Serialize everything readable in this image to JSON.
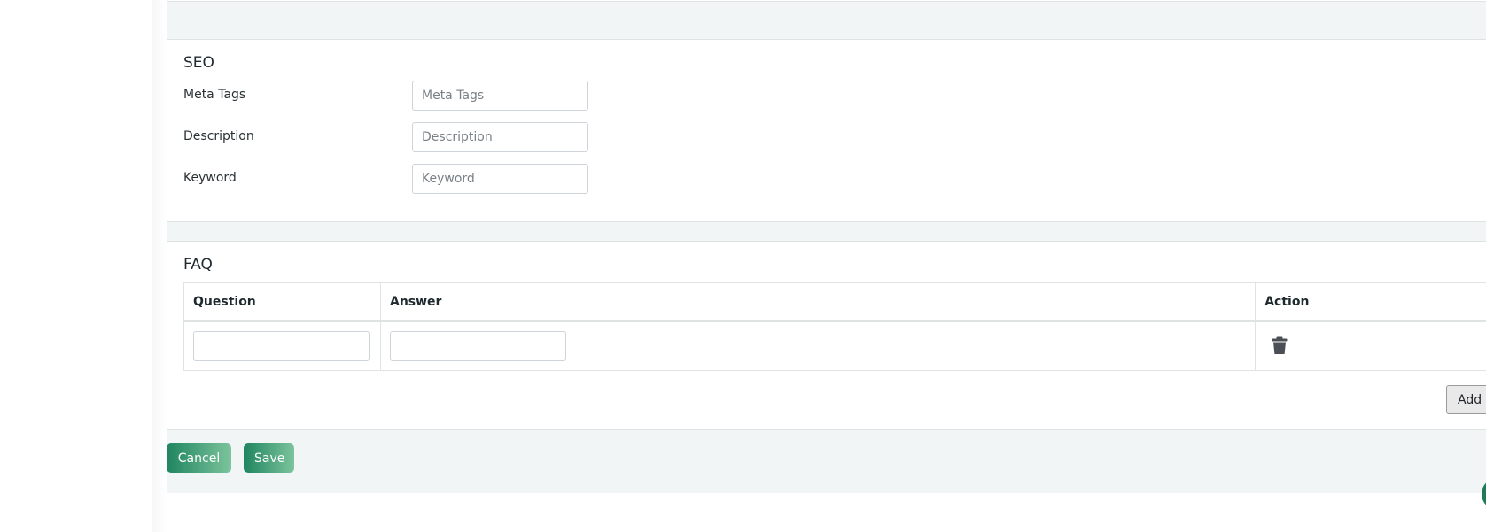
{
  "seo": {
    "title": "SEO",
    "fields": [
      {
        "label": "Meta Tags",
        "placeholder": "Meta Tags",
        "value": ""
      },
      {
        "label": "Description",
        "placeholder": "Description",
        "value": ""
      },
      {
        "label": "Keyword",
        "placeholder": "Keyword",
        "value": ""
      }
    ]
  },
  "faq": {
    "title": "FAQ",
    "columns": [
      "Question",
      "Answer",
      "Action"
    ],
    "rows": [
      {
        "question": "",
        "answer": ""
      }
    ],
    "add_more_label": "Add More"
  },
  "actions": {
    "cancel_label": "Cancel",
    "save_label": "Save"
  },
  "icons": {
    "delete": "trash-icon"
  },
  "colors": {
    "accent_start": "#1f8560",
    "accent_end": "#7cc49c",
    "page_bg": "#f1f5f5",
    "card_border": "#dfe3e3"
  }
}
